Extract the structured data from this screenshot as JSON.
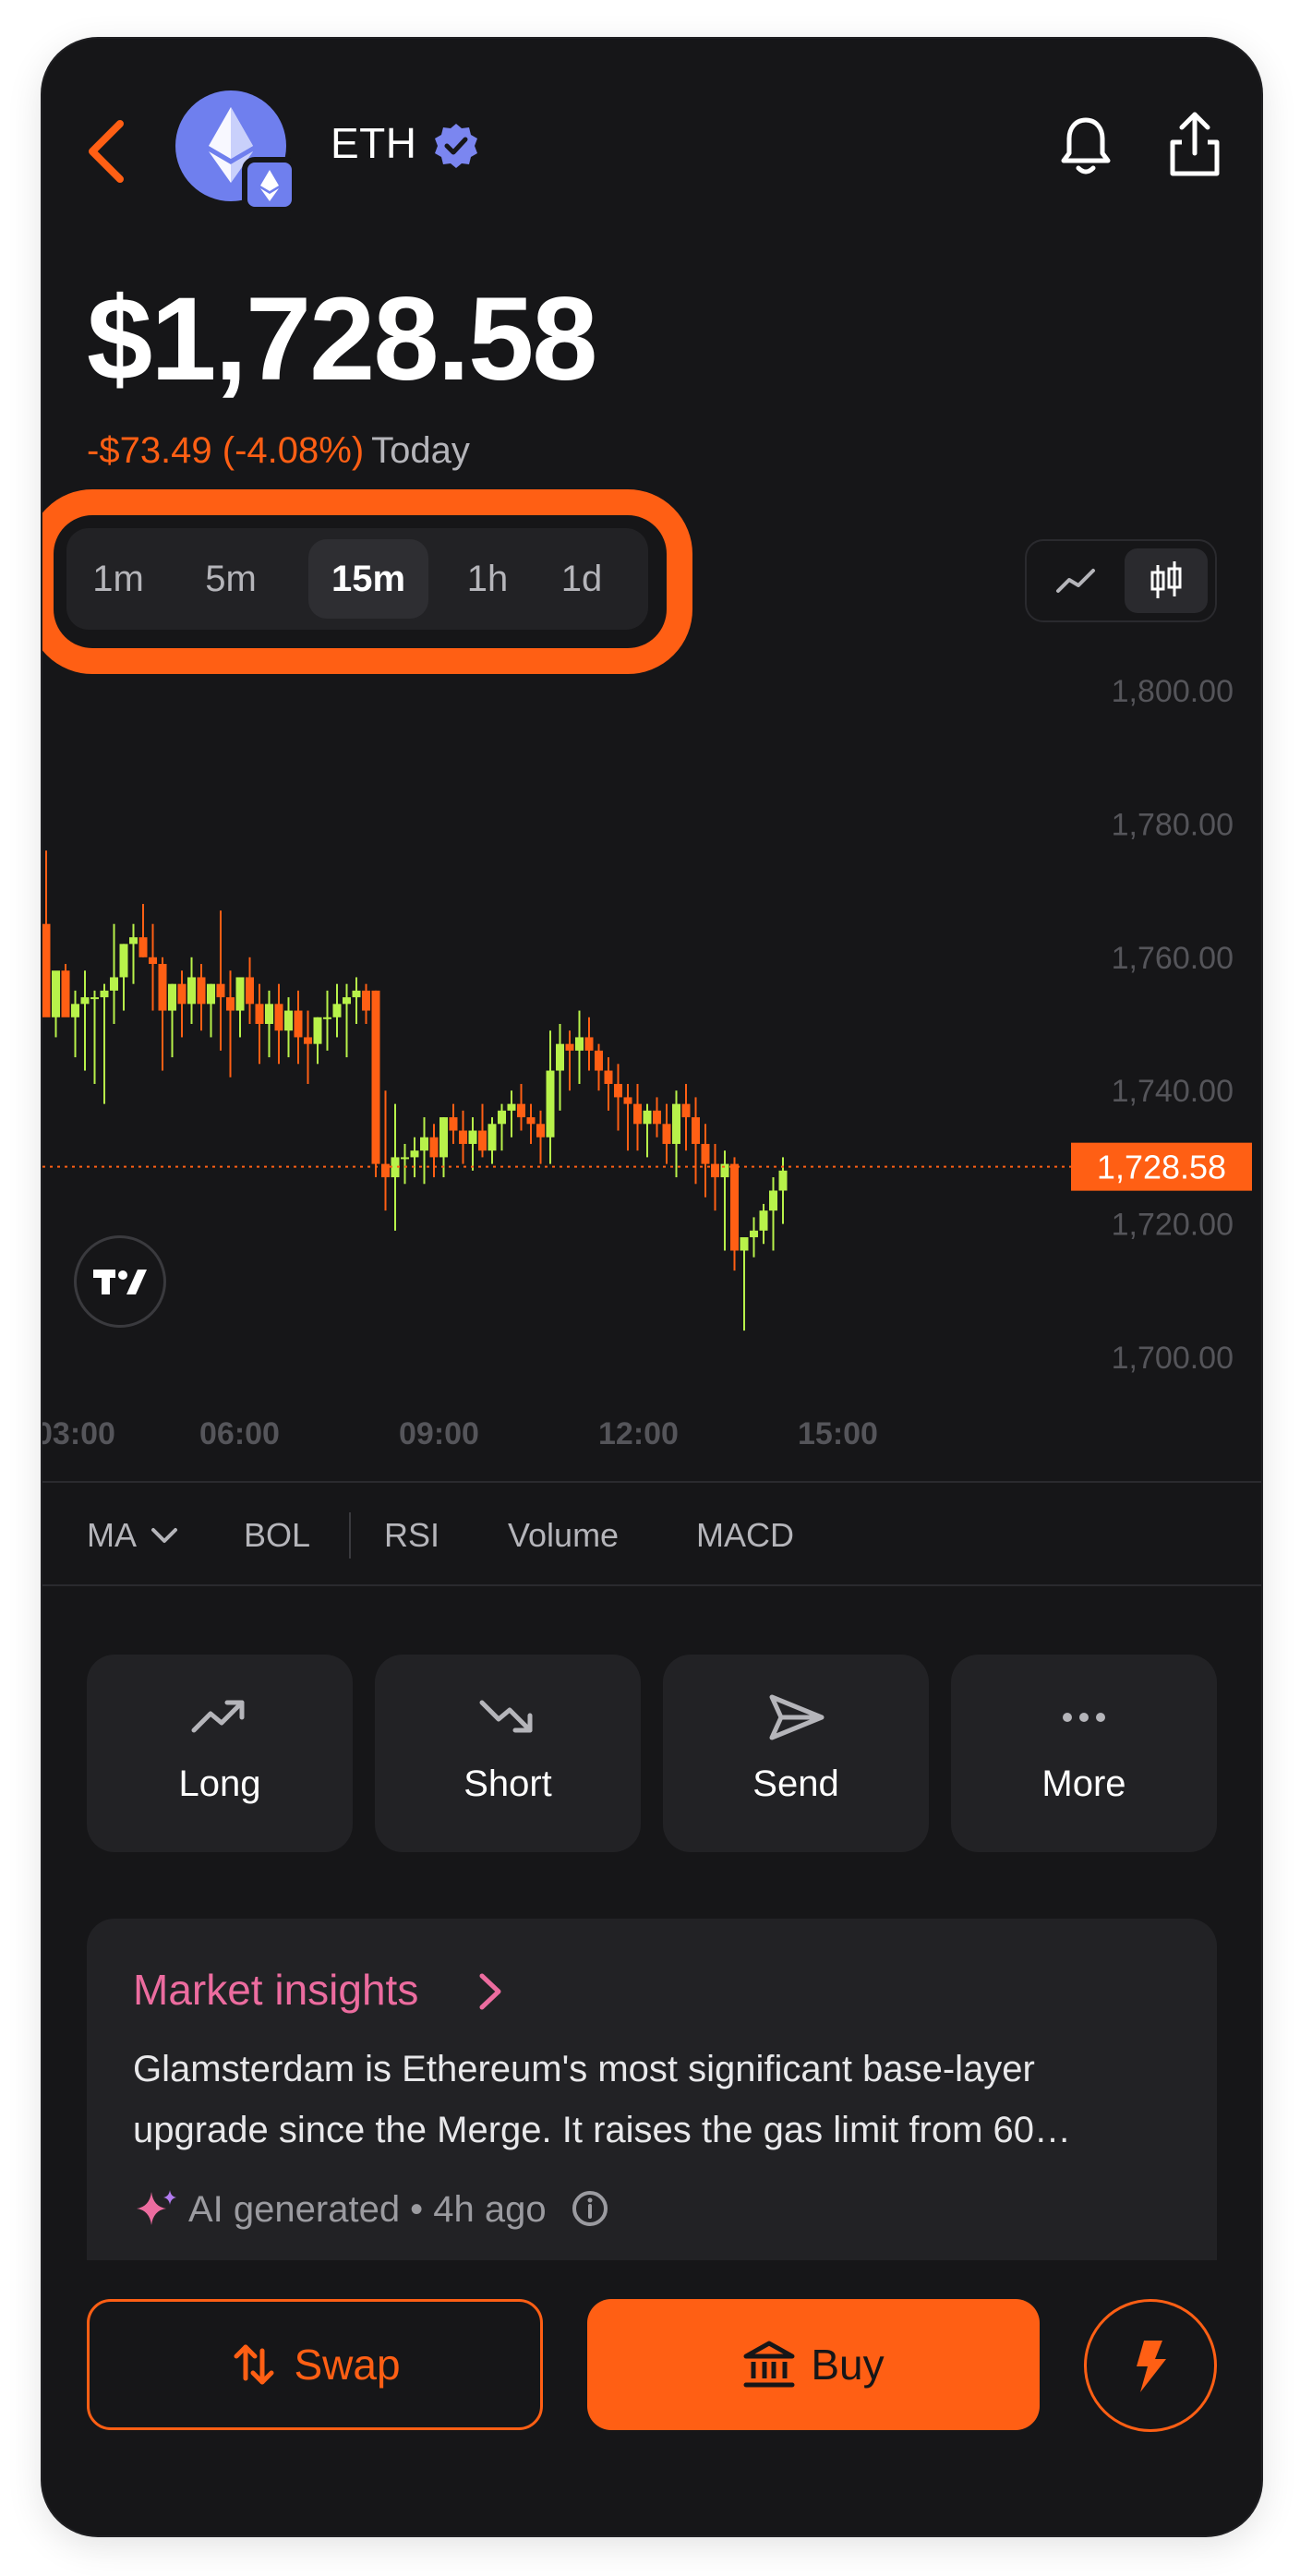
{
  "header": {
    "ticker": "ETH",
    "price": "$1,728.58",
    "change": "-$73.49 (-4.08%)",
    "period": "Today"
  },
  "timeframes": {
    "items": [
      "1m",
      "5m",
      "15m",
      "1h",
      "1d"
    ],
    "selected": "15m"
  },
  "chart_data": {
    "type": "candlestick",
    "interval": "15m",
    "y_ticks": [
      "1,800.00",
      "1,780.00",
      "1,760.00",
      "1,740.00",
      "1,720.00",
      "1,700.00"
    ],
    "x_ticks": [
      "03:00",
      "06:00",
      "09:00",
      "12:00",
      "15:00"
    ],
    "ylim": [
      1700,
      1800
    ],
    "current_price_label": "1,728.58",
    "current_price": 1728.58,
    "up_color": "#b8f24a",
    "down_color": "#ff5f14",
    "candles": [
      [
        1765,
        1776,
        1752,
        1751
      ],
      [
        1751,
        1756,
        1748,
        1758
      ],
      [
        1758,
        1759,
        1752,
        1751
      ],
      [
        1751,
        1755,
        1745,
        1753
      ],
      [
        1753,
        1758,
        1743,
        1754
      ],
      [
        1754,
        1755,
        1741,
        1754
      ],
      [
        1754,
        1756,
        1738,
        1755
      ],
      [
        1755,
        1765,
        1750,
        1757
      ],
      [
        1757,
        1762,
        1752,
        1762
      ],
      [
        1762,
        1765,
        1756,
        1763
      ],
      [
        1763,
        1768,
        1760,
        1760
      ],
      [
        1760,
        1765,
        1752,
        1759
      ],
      [
        1759,
        1760,
        1743,
        1752
      ],
      [
        1752,
        1756,
        1745,
        1756
      ],
      [
        1756,
        1758,
        1748,
        1753
      ],
      [
        1753,
        1760,
        1750,
        1757
      ],
      [
        1757,
        1759,
        1749,
        1753
      ],
      [
        1753,
        1756,
        1748,
        1756
      ],
      [
        1756,
        1767,
        1746,
        1754
      ],
      [
        1754,
        1758,
        1742,
        1752
      ],
      [
        1752,
        1756,
        1748,
        1757
      ],
      [
        1757,
        1760,
        1750,
        1753
      ],
      [
        1753,
        1756,
        1744,
        1750
      ],
      [
        1750,
        1755,
        1745,
        1753
      ],
      [
        1753,
        1756,
        1744,
        1749
      ],
      [
        1749,
        1754,
        1745,
        1752
      ],
      [
        1752,
        1755,
        1744,
        1748
      ],
      [
        1748,
        1752,
        1741,
        1747
      ],
      [
        1747,
        1751,
        1744,
        1751
      ],
      [
        1751,
        1755,
        1746,
        1751
      ],
      [
        1751,
        1756,
        1748,
        1753
      ],
      [
        1753,
        1756,
        1745,
        1754
      ],
      [
        1754,
        1757,
        1750,
        1755
      ],
      [
        1755,
        1756,
        1750,
        1752
      ],
      [
        1755,
        1755,
        1727,
        1729
      ],
      [
        1729,
        1740,
        1722,
        1727
      ],
      [
        1727,
        1738,
        1719,
        1730
      ],
      [
        1730,
        1732,
        1726,
        1730
      ],
      [
        1730,
        1733,
        1727,
        1731
      ],
      [
        1731,
        1736,
        1726,
        1733
      ],
      [
        1733,
        1735,
        1727,
        1730
      ],
      [
        1730,
        1736,
        1727,
        1736
      ],
      [
        1736,
        1738,
        1732,
        1734
      ],
      [
        1734,
        1737,
        1729,
        1732
      ],
      [
        1732,
        1736,
        1728,
        1734
      ],
      [
        1734,
        1738,
        1730,
        1731
      ],
      [
        1731,
        1736,
        1729,
        1735
      ],
      [
        1735,
        1738,
        1731,
        1737
      ],
      [
        1737,
        1740,
        1733,
        1738
      ],
      [
        1738,
        1741,
        1734,
        1736
      ],
      [
        1736,
        1738,
        1732,
        1735
      ],
      [
        1735,
        1737,
        1729,
        1733
      ],
      [
        1733,
        1749,
        1729,
        1743
      ],
      [
        1743,
        1750,
        1737,
        1747
      ],
      [
        1747,
        1749,
        1740,
        1746
      ],
      [
        1746,
        1752,
        1741,
        1748
      ],
      [
        1748,
        1751,
        1743,
        1746
      ],
      [
        1746,
        1747,
        1740,
        1743
      ],
      [
        1743,
        1745,
        1737,
        1741
      ],
      [
        1741,
        1744,
        1734,
        1739
      ],
      [
        1739,
        1741,
        1731,
        1738
      ],
      [
        1738,
        1741,
        1731,
        1735
      ],
      [
        1735,
        1738,
        1730,
        1737
      ],
      [
        1737,
        1739,
        1733,
        1735
      ],
      [
        1735,
        1738,
        1729,
        1732
      ],
      [
        1732,
        1740,
        1727,
        1738
      ],
      [
        1738,
        1741,
        1731,
        1736
      ],
      [
        1736,
        1739,
        1726,
        1732
      ],
      [
        1732,
        1735,
        1724,
        1729
      ],
      [
        1729,
        1732,
        1722,
        1727
      ],
      [
        1727,
        1731,
        1716,
        1729
      ],
      [
        1729,
        1730,
        1713,
        1716
      ],
      [
        1716,
        1717,
        1704,
        1718
      ],
      [
        1718,
        1721,
        1715,
        1719
      ],
      [
        1719,
        1723,
        1717,
        1722
      ],
      [
        1722,
        1727,
        1716,
        1725
      ],
      [
        1725,
        1730,
        1720,
        1728
      ]
    ]
  },
  "indicators": [
    "MA",
    "BOL",
    "RSI",
    "Volume",
    "MACD"
  ],
  "actions": [
    {
      "label": "Long",
      "icon": "trend-up-icon"
    },
    {
      "label": "Short",
      "icon": "trend-down-icon"
    },
    {
      "label": "Send",
      "icon": "send-icon"
    },
    {
      "label": "More",
      "icon": "more-icon"
    }
  ],
  "insights": {
    "title": "Market insights",
    "text": "Glamsterdam is Ethereum's most significant base-layer upgrade since the Merge. It raises the gas limit from 60…",
    "meta": "AI generated • 4h ago"
  },
  "bottom": {
    "swap_label": "Swap",
    "buy_label": "Buy"
  },
  "colors": {
    "accent": "#ff5f14",
    "positive": "#b8f24a",
    "background": "#161618",
    "card": "#222225",
    "insights_title": "#ec6c9f",
    "eth_blue": "#6f7fee"
  }
}
